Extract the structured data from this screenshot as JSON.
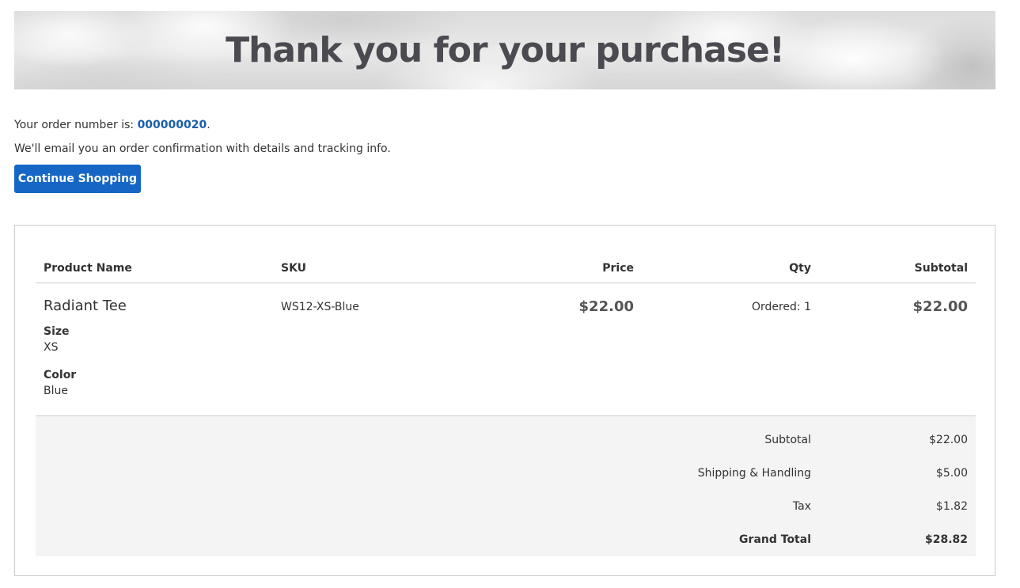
{
  "hero": {
    "title": "Thank you for your purchase!"
  },
  "order": {
    "number_prefix": "Your order number is: ",
    "number": "000000020",
    "number_suffix": ".",
    "email_note": "We'll email you an order confirmation with details and tracking info.",
    "continue_label": "Continue Shopping"
  },
  "table": {
    "headers": {
      "product_name": "Product Name",
      "sku": "SKU",
      "price": "Price",
      "qty": "Qty",
      "subtotal": "Subtotal"
    },
    "items": [
      {
        "name": "Radiant Tee",
        "options": [
          {
            "label": "Size",
            "value": "XS"
          },
          {
            "label": "Color",
            "value": "Blue"
          }
        ],
        "sku": "WS12-XS-Blue",
        "price": "$22.00",
        "qty": "Ordered: 1",
        "subtotal": "$22.00"
      }
    ]
  },
  "totals": [
    {
      "label": "Subtotal",
      "value": "$22.00"
    },
    {
      "label": "Shipping & Handling",
      "value": "$5.00"
    },
    {
      "label": "Tax",
      "value": "$1.82"
    },
    {
      "label": "Grand Total",
      "value": "$28.82"
    }
  ],
  "colors": {
    "primary_button": "#1566c5",
    "order_number_link": "#1a5ea8",
    "totals_background": "#f4f4f4"
  }
}
